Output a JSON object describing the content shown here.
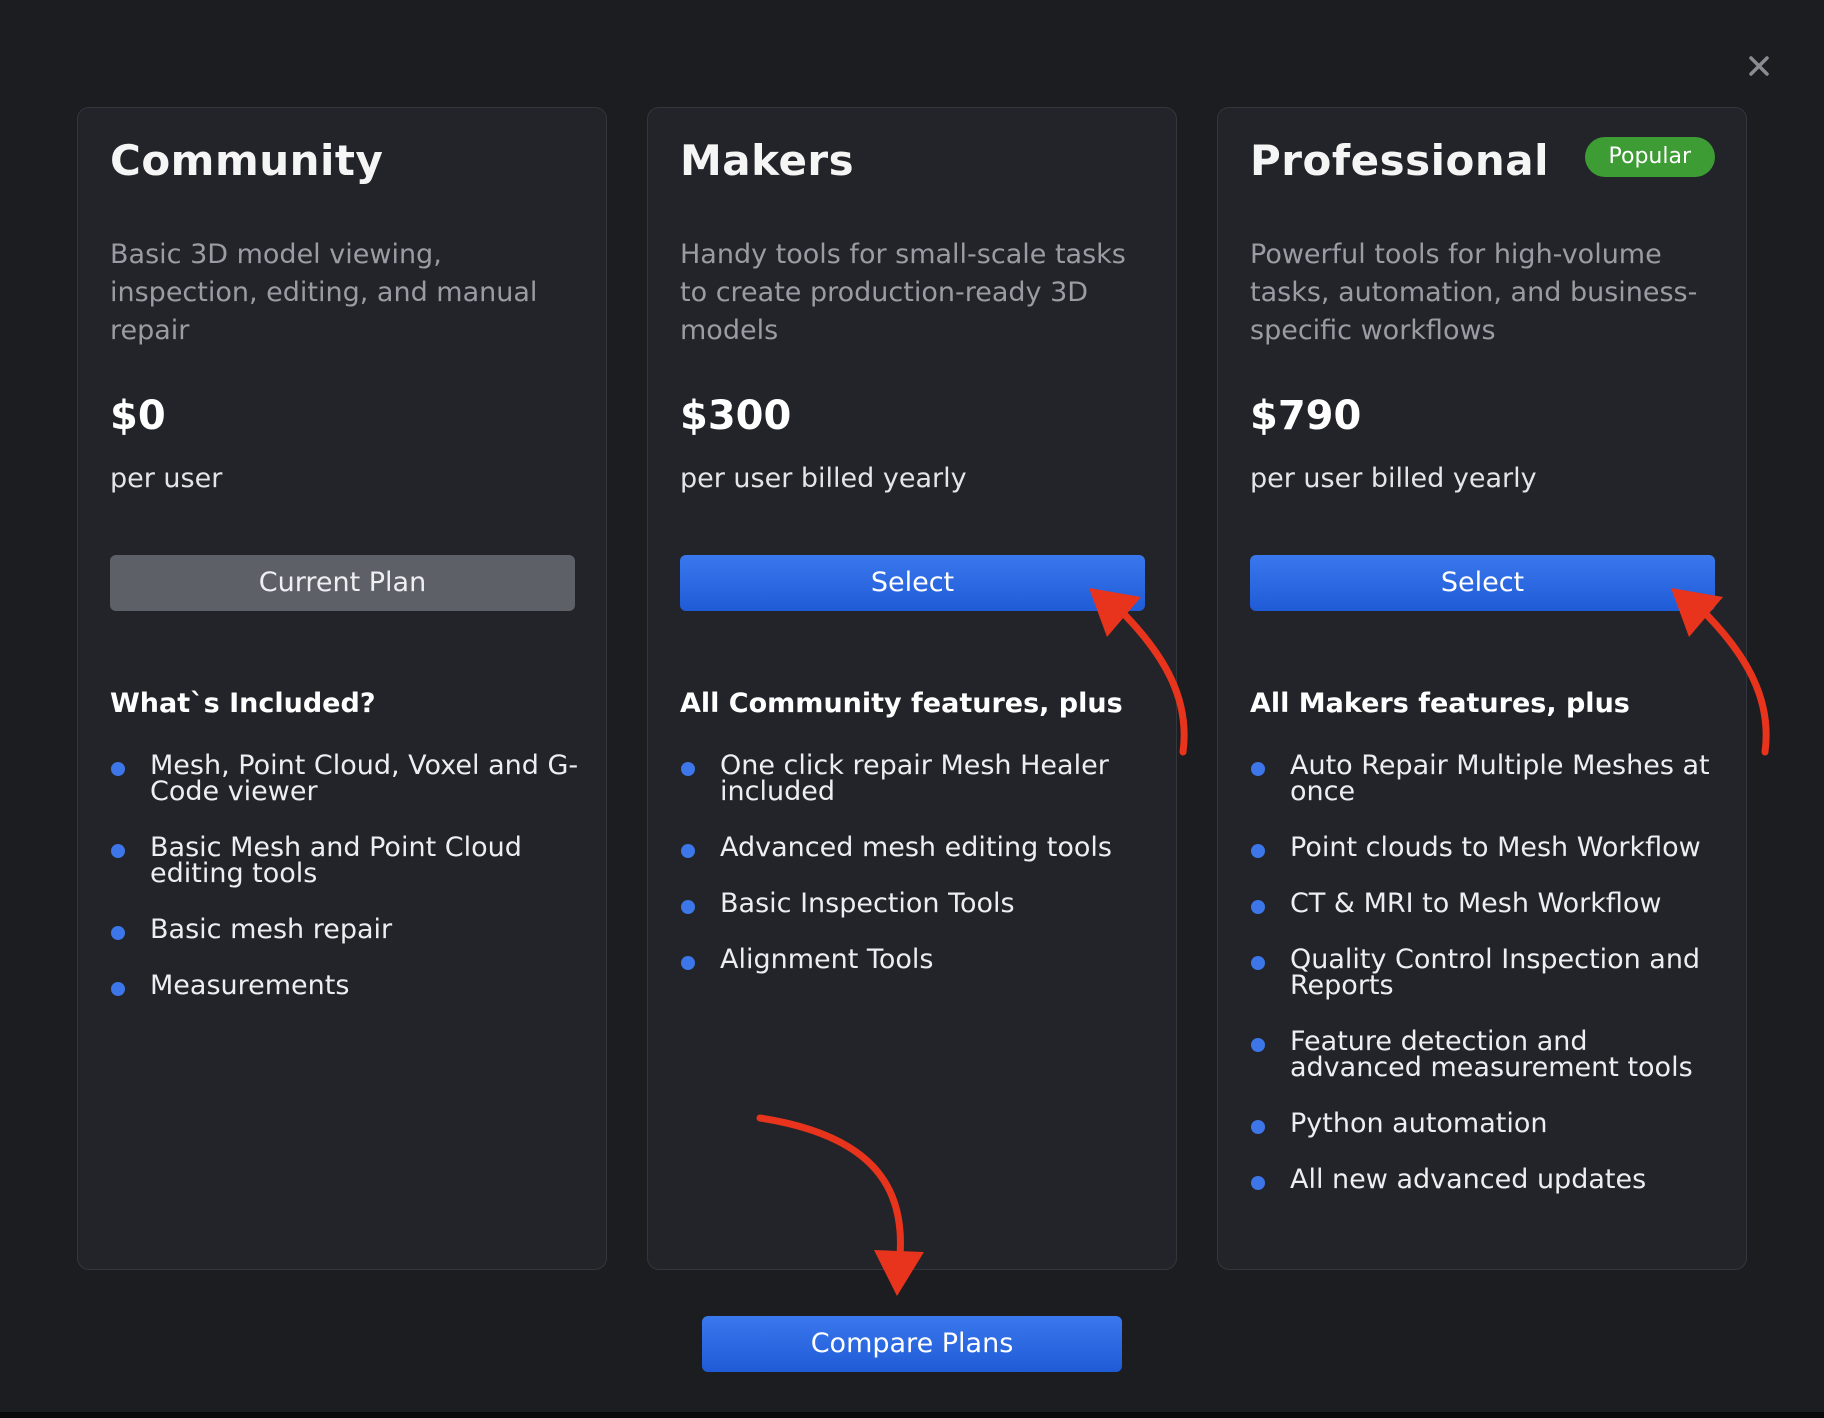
{
  "close_icon": "close-icon",
  "colors": {
    "background": "#1c1d21",
    "card": "#232429",
    "accent_blue": "#2f6ae3",
    "badge_green": "#3e9c35",
    "current_plan_gray": "#5e6068",
    "bullet": "#3d76e8",
    "annotation_arrow": "#e8341c"
  },
  "plans": [
    {
      "name": "Community",
      "description": "Basic 3D model viewing, inspection, editing, and manual repair",
      "price": "$0",
      "period": "per user",
      "button_label": "Current Plan",
      "features_heading": "What`s Included?",
      "features": [
        "Mesh, Point Cloud, Voxel and G-Code viewer",
        "Basic Mesh and Point Cloud editing tools",
        "Basic mesh repair",
        "Measurements"
      ]
    },
    {
      "name": "Makers",
      "description": "Handy tools for small-scale tasks to create production-ready 3D models",
      "price": "$300",
      "period": "per user billed yearly",
      "button_label": "Select",
      "features_heading": "All Community features, plus",
      "features": [
        "One click repair Mesh Healer included",
        "Advanced mesh editing tools",
        "Basic Inspection Tools",
        "Alignment Tools"
      ]
    },
    {
      "name": "Professional",
      "badge": "Popular",
      "description": "Powerful tools for high-volume tasks, automation, and business-specific workflows",
      "price": "$790",
      "period": "per user billed yearly",
      "button_label": "Select",
      "features_heading": "All Makers features, plus",
      "features": [
        "Auto Repair Multiple Meshes at once",
        "Point clouds to Mesh Workflow",
        "CT & MRI to Mesh Workflow",
        "Quality Control Inspection and Reports",
        "Feature detection and advanced measurement tools",
        "Python automation",
        "All new advanced updates"
      ]
    }
  ],
  "compare_label": "Compare Plans"
}
